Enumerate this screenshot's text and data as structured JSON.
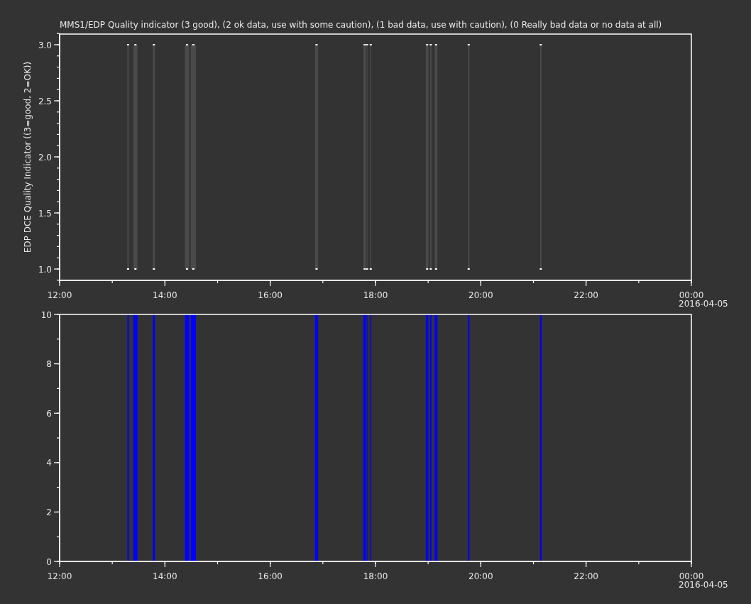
{
  "panels": [
    {
      "kind": "range",
      "chart_data": {
        "type": "bar",
        "title": "MMS1/EDP  Quality indicator (3 good), (2 ok data, use with some caution), (1 bad data, use with caution), (0 Really bad data or no data at all)",
        "ylabel": "EDP DCE Quality Indicator ((3=good, 2=OK))",
        "bands": [
          {
            "axis": "x",
            "from": 13.287,
            "to": 13.313,
            "color": "#4a4a4a"
          },
          {
            "axis": "x",
            "from": 13.4,
            "to": 13.48,
            "color": "#4a4a4a"
          },
          {
            "axis": "x",
            "from": 13.77,
            "to": 13.81,
            "color": "#4a4a4a"
          },
          {
            "axis": "x",
            "from": 14.38,
            "to": 14.46,
            "color": "#4a4a4a"
          },
          {
            "axis": "x",
            "from": 14.49,
            "to": 14.59,
            "color": "#4a4a4a"
          },
          {
            "axis": "x",
            "from": 16.85,
            "to": 16.91,
            "color": "#4a4a4a"
          },
          {
            "axis": "x",
            "from": 17.77,
            "to": 17.82,
            "color": "#4a4a4a"
          },
          {
            "axis": "x",
            "from": 17.833,
            "to": 17.847,
            "color": "#4a4a4a"
          },
          {
            "axis": "x",
            "from": 17.9,
            "to": 17.92,
            "color": "#4a4a4a"
          },
          {
            "axis": "x",
            "from": 18.955,
            "to": 19.005,
            "color": "#4a4a4a"
          },
          {
            "axis": "x",
            "from": 19.036,
            "to": 19.064,
            "color": "#4a4a4a"
          },
          {
            "axis": "x",
            "from": 19.124,
            "to": 19.176,
            "color": "#4a4a4a"
          },
          {
            "axis": "x",
            "from": 19.755,
            "to": 19.785,
            "color": "#4a4a4a"
          },
          {
            "axis": "x",
            "from": 21.126,
            "to": 21.154,
            "color": "#4a4a4a"
          }
        ],
        "x": [
          13.3,
          13.44,
          13.79,
          14.42,
          14.54,
          16.88,
          17.795,
          17.84,
          17.91,
          18.98,
          19.05,
          19.15,
          19.77,
          21.14
        ],
        "series": [
          {
            "type": "scatter",
            "color": "#ffffff",
            "values": [
              3,
              3,
              3,
              3,
              3,
              3,
              3,
              3,
              3,
              3,
              3,
              3,
              3,
              3
            ]
          },
          {
            "type": "scatter",
            "color": "#ffffff",
            "values": [
              1,
              1,
              1,
              1,
              1,
              1,
              1,
              1,
              1,
              1,
              1,
              1,
              1,
              1
            ]
          }
        ],
        "xlim": [
          12,
          24
        ],
        "ylim": [
          0.9,
          3.1
        ],
        "xticks": [
          {
            "value": 12,
            "label": "12:00"
          },
          {
            "value": 14,
            "label": "14:00"
          },
          {
            "value": 16,
            "label": "16:00"
          },
          {
            "value": 18,
            "label": "18:00"
          },
          {
            "value": 20,
            "label": "20:00"
          },
          {
            "value": 22,
            "label": "22:00"
          },
          {
            "value": 24,
            "label": "00:00"
          }
        ],
        "yticks": [
          {
            "value": 1,
            "label": "1.0"
          },
          {
            "value": 1.5,
            "label": "1.5"
          },
          {
            "value": 2,
            "label": "2.0"
          },
          {
            "value": 2.5,
            "label": "2.5"
          },
          {
            "value": 3,
            "label": "3.0"
          }
        ],
        "annotations": [
          "2016-04-05"
        ]
      }
    },
    {
      "kind": "bar",
      "chart_data": {
        "type": "bar",
        "bands": [
          {
            "axis": "x",
            "from": 13.287,
            "to": 13.313,
            "color": "#0000ff"
          },
          {
            "axis": "x",
            "from": 13.4,
            "to": 13.48,
            "color": "#0000ff"
          },
          {
            "axis": "x",
            "from": 13.77,
            "to": 13.81,
            "color": "#0000ff"
          },
          {
            "axis": "x",
            "from": 14.38,
            "to": 14.46,
            "color": "#0000ff"
          },
          {
            "axis": "x",
            "from": 14.49,
            "to": 14.59,
            "color": "#0000ff"
          },
          {
            "axis": "x",
            "from": 16.85,
            "to": 16.91,
            "color": "#0000ff"
          },
          {
            "axis": "x",
            "from": 17.77,
            "to": 17.82,
            "color": "#0000ff"
          },
          {
            "axis": "x",
            "from": 17.833,
            "to": 17.847,
            "color": "#0000ff"
          },
          {
            "axis": "x",
            "from": 17.9,
            "to": 17.92,
            "color": "#0000ff"
          },
          {
            "axis": "x",
            "from": 18.955,
            "to": 19.005,
            "color": "#0000ff"
          },
          {
            "axis": "x",
            "from": 19.036,
            "to": 19.064,
            "color": "#0000ff"
          },
          {
            "axis": "x",
            "from": 19.124,
            "to": 19.176,
            "color": "#0000ff"
          },
          {
            "axis": "x",
            "from": 19.755,
            "to": 19.785,
            "color": "#0000ff"
          },
          {
            "axis": "x",
            "from": 21.126,
            "to": 21.154,
            "color": "#0000ff"
          }
        ],
        "xlim": [
          12,
          24
        ],
        "ylim": [
          0,
          10
        ],
        "xticks": [
          {
            "value": 12,
            "label": "12:00"
          },
          {
            "value": 14,
            "label": "14:00"
          },
          {
            "value": 16,
            "label": "16:00"
          },
          {
            "value": 18,
            "label": "18:00"
          },
          {
            "value": 20,
            "label": "20:00"
          },
          {
            "value": 22,
            "label": "22:00"
          },
          {
            "value": 24,
            "label": "00:00"
          }
        ],
        "yticks": [
          {
            "value": 0,
            "label": "0"
          },
          {
            "value": 2,
            "label": "2"
          },
          {
            "value": 4,
            "label": "4"
          },
          {
            "value": 6,
            "label": "6"
          },
          {
            "value": 8,
            "label": "8"
          },
          {
            "value": 10,
            "label": "10"
          }
        ],
        "annotations": [
          "2016-04-05"
        ]
      }
    }
  ]
}
